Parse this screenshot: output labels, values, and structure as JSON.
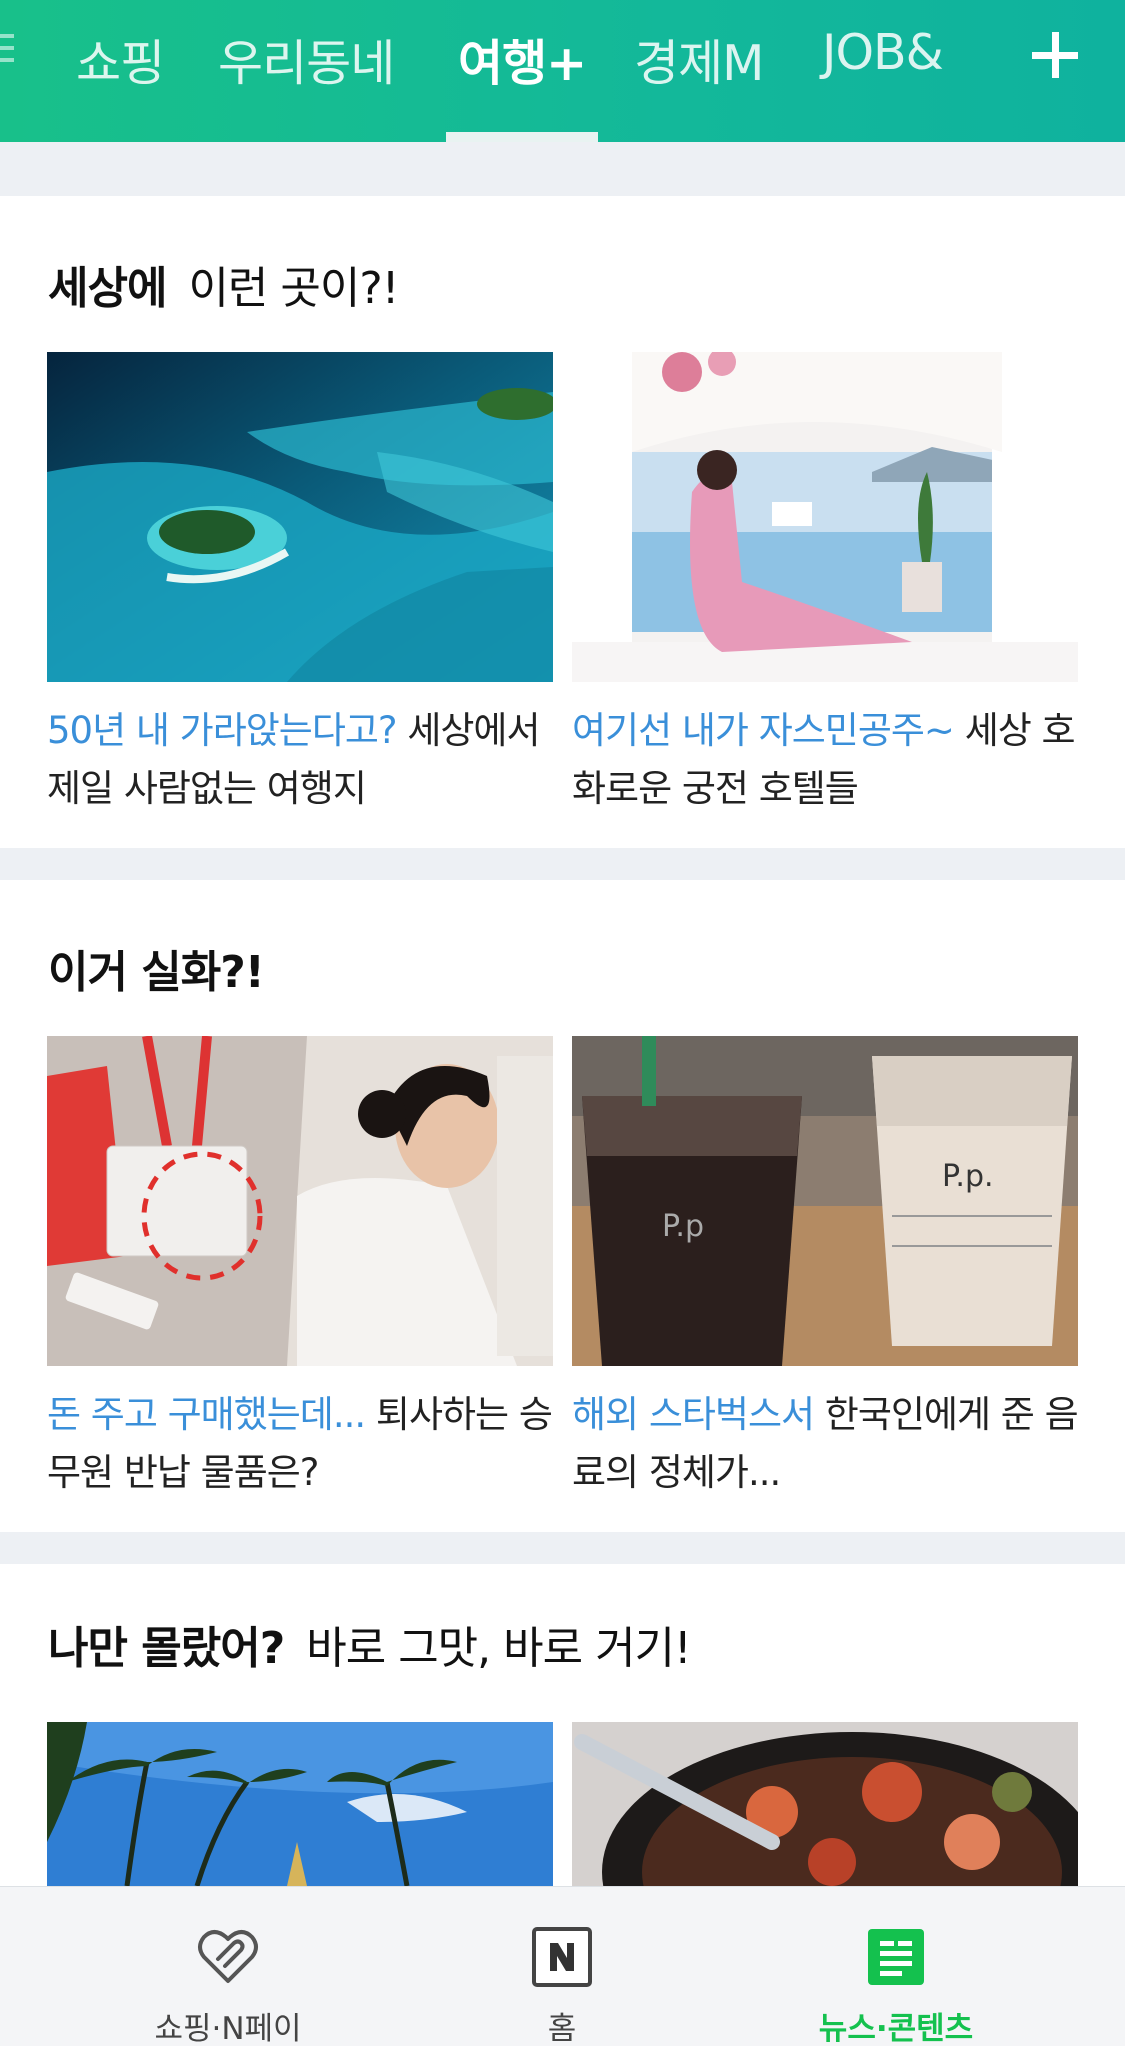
{
  "header": {
    "tabs": [
      {
        "label": "쇼핑",
        "active": false
      },
      {
        "label": "우리동네",
        "active": false
      },
      {
        "label": "여행+",
        "active": true
      },
      {
        "label": "경제M",
        "active": false
      },
      {
        "label": "JOB&",
        "active": false
      }
    ],
    "add_icon": "plus-icon",
    "accent_color": "#15bc92"
  },
  "sections": [
    {
      "title_strong": "세상에",
      "title_normal": "이런 곳이?!",
      "cards": [
        {
          "highlight": "50년 내 가라앉는다고?",
          "text": " 세상에서 제일 사람없는 여행지",
          "image": "aerial-island-photo"
        },
        {
          "highlight": "여기선 내가 자스민공주~",
          "text": " 세상 호화로운 궁전 호텔들",
          "image": "palace-hotel-photo"
        }
      ]
    },
    {
      "title_strong": "이거 실화?!",
      "title_normal": "",
      "cards": [
        {
          "highlight": "돈 주고 구매했는데...",
          "text": " 퇴사하는 승무원 반납 물품은?",
          "image": "flight-attendant-photo"
        },
        {
          "highlight": "해외 스타벅스서",
          "text": " 한국인에게 준 음료의 정체가...",
          "image": "iced-drinks-photo"
        }
      ]
    },
    {
      "title_strong": "나만 몰랐어?",
      "title_normal": "바로 그맛, 바로 거기!",
      "cards": [
        {
          "highlight": "",
          "text": "",
          "image": "palm-trees-photo"
        },
        {
          "highlight": "",
          "text": "",
          "image": "stew-pot-photo"
        }
      ]
    }
  ],
  "bottom_nav": {
    "items": [
      {
        "label": "쇼핑·N페이",
        "icon": "heart-tag-icon",
        "active": false
      },
      {
        "label": "홈",
        "icon": "naver-n-icon",
        "active": false
      },
      {
        "label": "뉴스·콘텐츠",
        "icon": "news-icon",
        "active": true
      }
    ],
    "active_color": "#14c14e"
  }
}
